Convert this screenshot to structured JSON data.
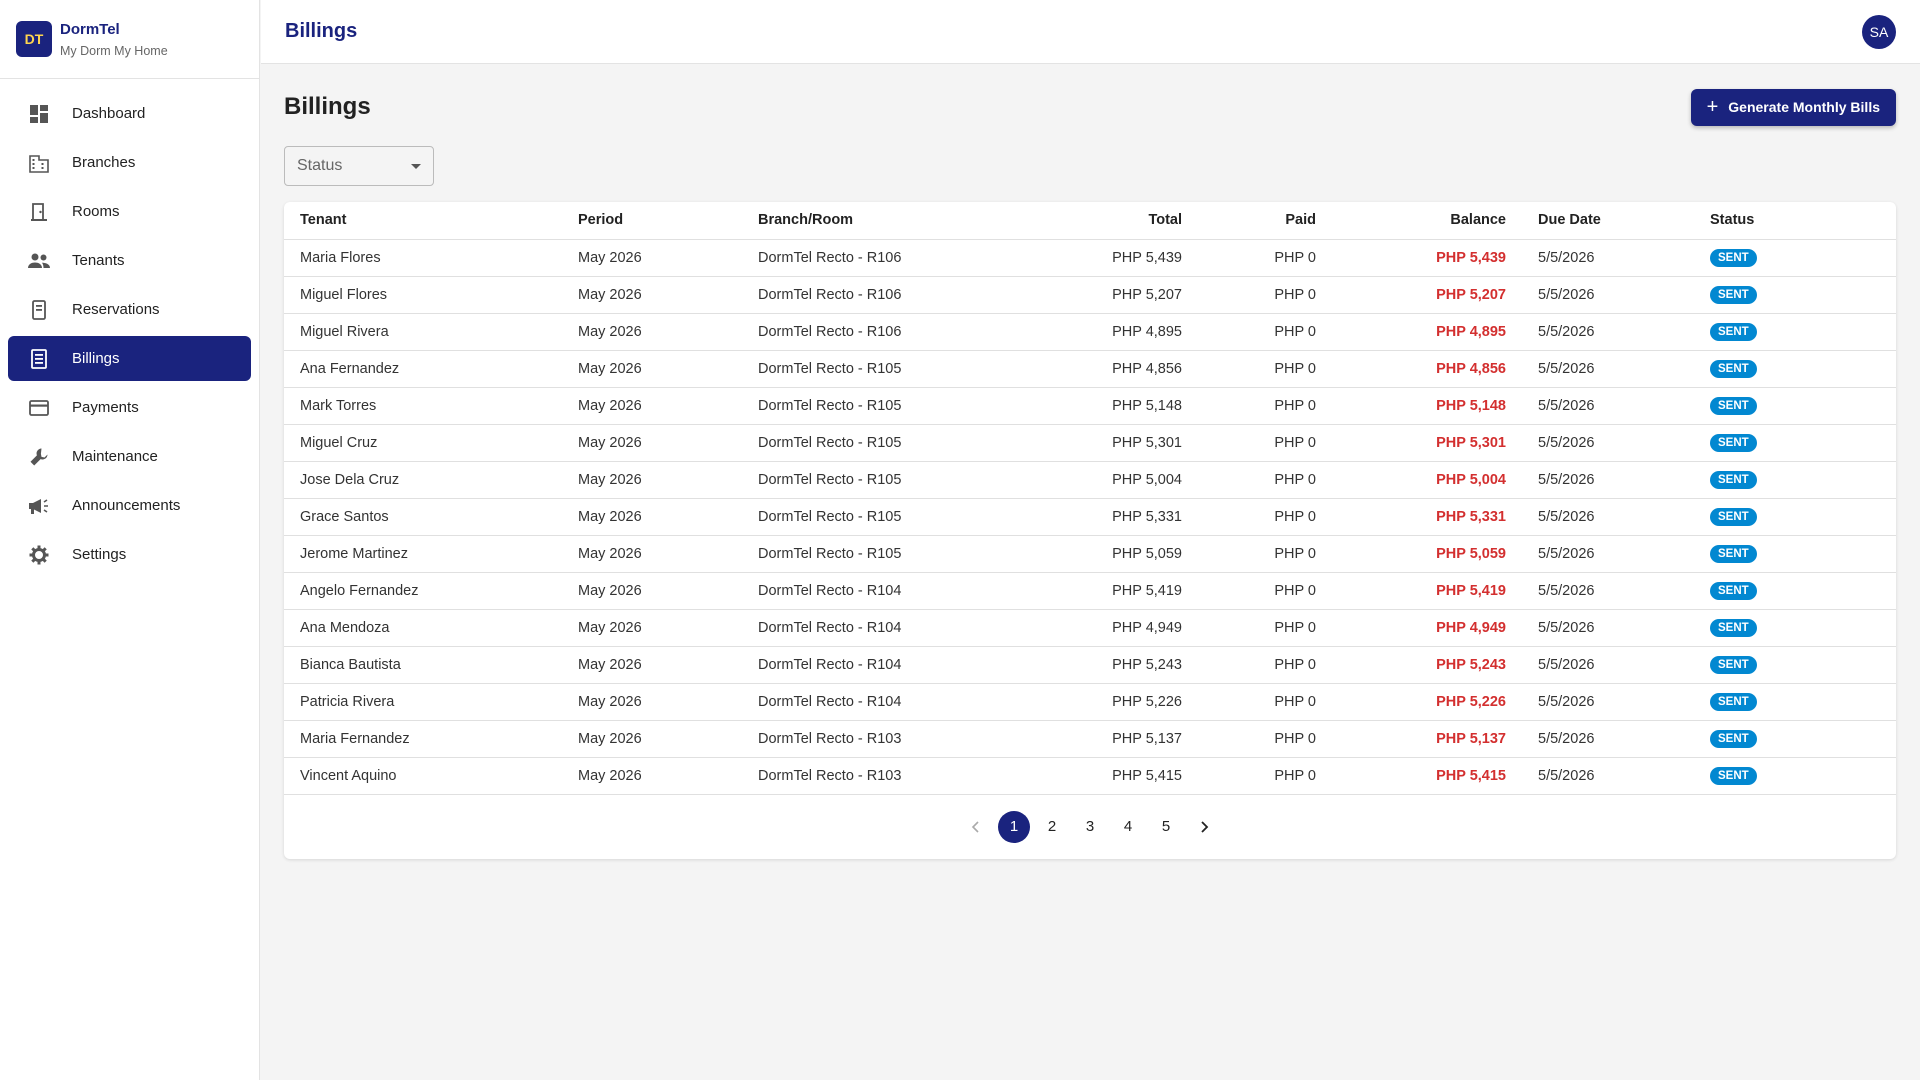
{
  "brand": {
    "initials": "DT",
    "name": "DormTel",
    "tagline": "My Dorm My Home"
  },
  "nav": [
    {
      "label": "Dashboard",
      "icon": "dashboard-icon",
      "active": false
    },
    {
      "label": "Branches",
      "icon": "building-icon",
      "active": false
    },
    {
      "label": "Rooms",
      "icon": "door-icon",
      "active": false
    },
    {
      "label": "Tenants",
      "icon": "people-icon",
      "active": false
    },
    {
      "label": "Reservations",
      "icon": "book-icon",
      "active": false
    },
    {
      "label": "Billings",
      "icon": "receipt-icon",
      "active": true
    },
    {
      "label": "Payments",
      "icon": "credit-card-icon",
      "active": false
    },
    {
      "label": "Maintenance",
      "icon": "wrench-icon",
      "active": false
    },
    {
      "label": "Announcements",
      "icon": "megaphone-icon",
      "active": false
    },
    {
      "label": "Settings",
      "icon": "gear-icon",
      "active": false
    }
  ],
  "topbar": {
    "title": "Billings",
    "avatar": "SA"
  },
  "page": {
    "title": "Billings",
    "generate_label": "Generate Monthly Bills",
    "status_placeholder": "Status"
  },
  "table": {
    "columns": [
      "Tenant",
      "Period",
      "Branch/Room",
      "Total",
      "Paid",
      "Balance",
      "Due Date",
      "Status"
    ],
    "rows": [
      [
        "Maria Flores",
        "May 2026",
        "DormTel Recto - R106",
        "PHP 5,439",
        "PHP 0",
        "PHP 5,439",
        "5/5/2026",
        "SENT"
      ],
      [
        "Miguel Flores",
        "May 2026",
        "DormTel Recto - R106",
        "PHP 5,207",
        "PHP 0",
        "PHP 5,207",
        "5/5/2026",
        "SENT"
      ],
      [
        "Miguel Rivera",
        "May 2026",
        "DormTel Recto - R106",
        "PHP 4,895",
        "PHP 0",
        "PHP 4,895",
        "5/5/2026",
        "SENT"
      ],
      [
        "Ana Fernandez",
        "May 2026",
        "DormTel Recto - R105",
        "PHP 4,856",
        "PHP 0",
        "PHP 4,856",
        "5/5/2026",
        "SENT"
      ],
      [
        "Mark Torres",
        "May 2026",
        "DormTel Recto - R105",
        "PHP 5,148",
        "PHP 0",
        "PHP 5,148",
        "5/5/2026",
        "SENT"
      ],
      [
        "Miguel Cruz",
        "May 2026",
        "DormTel Recto - R105",
        "PHP 5,301",
        "PHP 0",
        "PHP 5,301",
        "5/5/2026",
        "SENT"
      ],
      [
        "Jose Dela Cruz",
        "May 2026",
        "DormTel Recto - R105",
        "PHP 5,004",
        "PHP 0",
        "PHP 5,004",
        "5/5/2026",
        "SENT"
      ],
      [
        "Grace Santos",
        "May 2026",
        "DormTel Recto - R105",
        "PHP 5,331",
        "PHP 0",
        "PHP 5,331",
        "5/5/2026",
        "SENT"
      ],
      [
        "Jerome Martinez",
        "May 2026",
        "DormTel Recto - R105",
        "PHP 5,059",
        "PHP 0",
        "PHP 5,059",
        "5/5/2026",
        "SENT"
      ],
      [
        "Angelo Fernandez",
        "May 2026",
        "DormTel Recto - R104",
        "PHP 5,419",
        "PHP 0",
        "PHP 5,419",
        "5/5/2026",
        "SENT"
      ],
      [
        "Ana Mendoza",
        "May 2026",
        "DormTel Recto - R104",
        "PHP 4,949",
        "PHP 0",
        "PHP 4,949",
        "5/5/2026",
        "SENT"
      ],
      [
        "Bianca Bautista",
        "May 2026",
        "DormTel Recto - R104",
        "PHP 5,243",
        "PHP 0",
        "PHP 5,243",
        "5/5/2026",
        "SENT"
      ],
      [
        "Patricia Rivera",
        "May 2026",
        "DormTel Recto - R104",
        "PHP 5,226",
        "PHP 0",
        "PHP 5,226",
        "5/5/2026",
        "SENT"
      ],
      [
        "Maria Fernandez",
        "May 2026",
        "DormTel Recto - R103",
        "PHP 5,137",
        "PHP 0",
        "PHP 5,137",
        "5/5/2026",
        "SENT"
      ],
      [
        "Vincent Aquino",
        "May 2026",
        "DormTel Recto - R103",
        "PHP 5,415",
        "PHP 0",
        "PHP 5,415",
        "5/5/2026",
        "SENT"
      ]
    ]
  },
  "pagination": {
    "pages": [
      "1",
      "2",
      "3",
      "4",
      "5"
    ],
    "current": "1"
  },
  "colors": {
    "primary": "#1a237e",
    "balance": "#d32f2f",
    "status_sent": "#0288d1"
  }
}
